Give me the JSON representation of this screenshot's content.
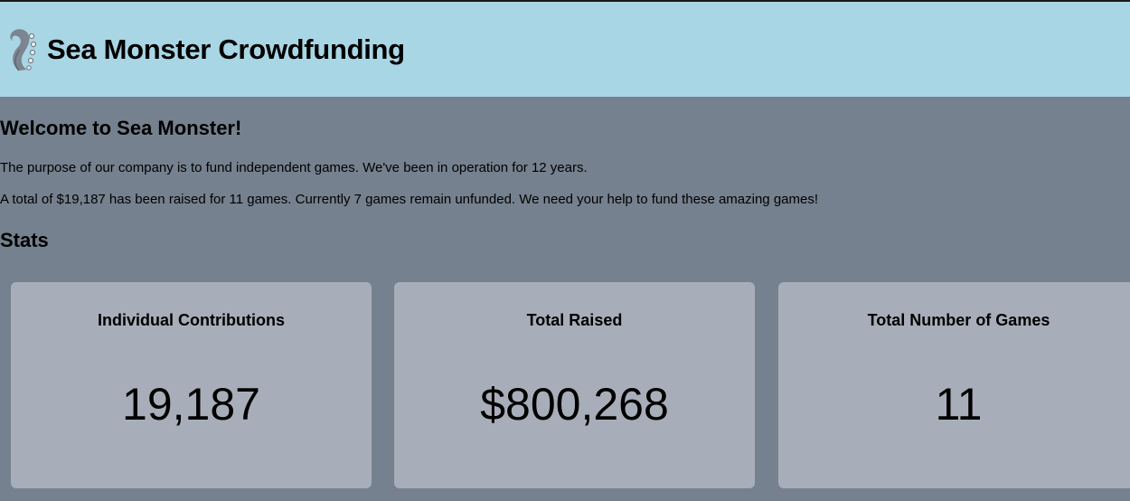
{
  "header": {
    "logo_icon": "sea-monster-tentacle-icon",
    "title": "Sea Monster Crowdfunding",
    "background_color": "#a9d6e4"
  },
  "welcome": {
    "title": "Welcome to Sea Monster!",
    "paragraph_1": "The purpose of our company is to fund independent games. We've been in operation for 12 years.",
    "paragraph_2": "A total of $19,187 has been raised for 11 games. Currently 7 games remain unfunded. We need your help to fund these amazing games!"
  },
  "stats": {
    "title": "Stats",
    "cards": [
      {
        "label": "Individual Contributions",
        "value": "19,187"
      },
      {
        "label": "Total Raised",
        "value": "$800,268"
      },
      {
        "label": "Total Number of Games",
        "value": "11"
      }
    ]
  },
  "colors": {
    "page_background": "#75818e",
    "card_background": "#a8aeb9"
  }
}
